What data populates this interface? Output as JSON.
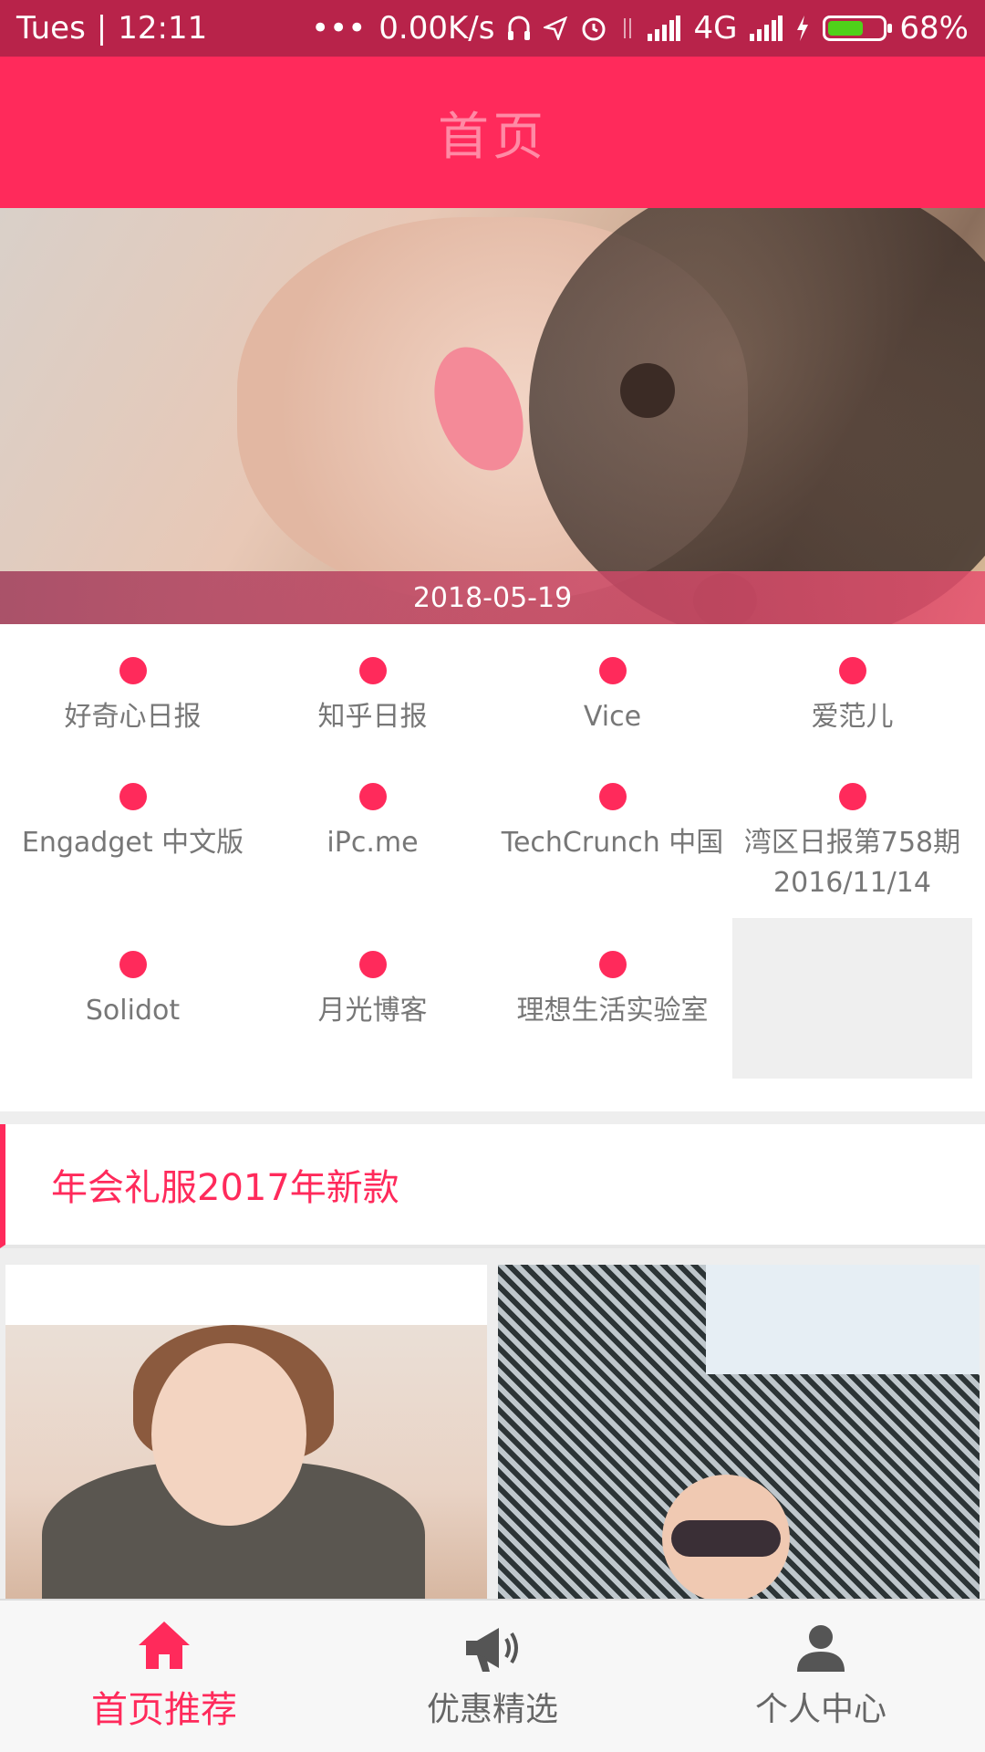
{
  "status_bar": {
    "day": "Tues",
    "time": "12:11",
    "network_speed": "0.00K/s",
    "network_type": "4G",
    "battery_percent": "68%",
    "battery_level": 0.68
  },
  "header": {
    "title": "首页"
  },
  "banner": {
    "date": "2018-05-19"
  },
  "categories": [
    {
      "label": "好奇心日报"
    },
    {
      "label": "知乎日报"
    },
    {
      "label": "Vice"
    },
    {
      "label": "爱范儿"
    },
    {
      "label": "Engadget 中文版"
    },
    {
      "label": "iPc.me"
    },
    {
      "label": "TechCrunch 中国"
    },
    {
      "label": "湾区日报第758期 2016/11/14"
    },
    {
      "label": "Solidot"
    },
    {
      "label": "月光博客"
    },
    {
      "label": "理想生活实验室"
    }
  ],
  "section": {
    "title": "年会礼服2017年新款"
  },
  "bottom_nav": {
    "items": [
      {
        "label": "首页推荐",
        "icon": "home-icon",
        "active": true
      },
      {
        "label": "优惠精选",
        "icon": "megaphone-icon",
        "active": false
      },
      {
        "label": "个人中心",
        "icon": "person-icon",
        "active": false
      }
    ]
  },
  "colors": {
    "accent": "#ff2a5b",
    "status_bar": "#b8234a",
    "text_muted": "#777777"
  }
}
